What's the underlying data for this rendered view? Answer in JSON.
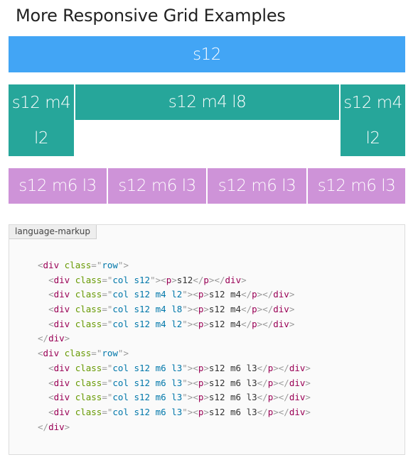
{
  "page": {
    "title": "More Responsive Grid Examples"
  },
  "grid": {
    "row1": {
      "label": "s12",
      "color": "#42a5f5"
    },
    "row2": [
      {
        "label_top": "s12 m4",
        "label_bottom": "l2",
        "color": "#26a69a"
      },
      {
        "label": "s12 m4 l8",
        "color": "#26a69a"
      },
      {
        "label_top": "s12 m4",
        "label_bottom": "l2",
        "color": "#26a69a"
      }
    ],
    "row3": [
      {
        "label": "s12 m6 l3",
        "color": "#ce93d8"
      },
      {
        "label": "s12 m6 l3",
        "color": "#ce93d8"
      },
      {
        "label": "s12 m6 l3",
        "color": "#ce93d8"
      },
      {
        "label": "s12 m6 l3",
        "color": "#ce93d8"
      }
    ]
  },
  "code_panel": {
    "language_tag": "language-markup",
    "lines": [
      {
        "indent": "",
        "tag": "div",
        "class": "row",
        "open": true
      },
      {
        "indent": "  ",
        "tag": "div",
        "class": "col s12",
        "inner": "s12"
      },
      {
        "indent": "  ",
        "tag": "div",
        "class": "col s12 m4 l2",
        "inner": "s12 m4"
      },
      {
        "indent": "  ",
        "tag": "div",
        "class": "col s12 m4 l8",
        "inner": "s12 m4"
      },
      {
        "indent": "  ",
        "tag": "div",
        "class": "col s12 m4 l2",
        "inner": "s12 m4"
      },
      {
        "indent": "",
        "close": "div"
      },
      {
        "indent": "",
        "tag": "div",
        "class": "row",
        "open": true
      },
      {
        "indent": "  ",
        "tag": "div",
        "class": "col s12 m6 l3",
        "inner": "s12 m6 l3"
      },
      {
        "indent": "  ",
        "tag": "div",
        "class": "col s12 m6 l3",
        "inner": "s12 m6 l3"
      },
      {
        "indent": "  ",
        "tag": "div",
        "class": "col s12 m6 l3",
        "inner": "s12 m6 l3"
      },
      {
        "indent": "  ",
        "tag": "div",
        "class": "col s12 m6 l3",
        "inner": "s12 m6 l3"
      },
      {
        "indent": "",
        "close": "div"
      }
    ]
  }
}
